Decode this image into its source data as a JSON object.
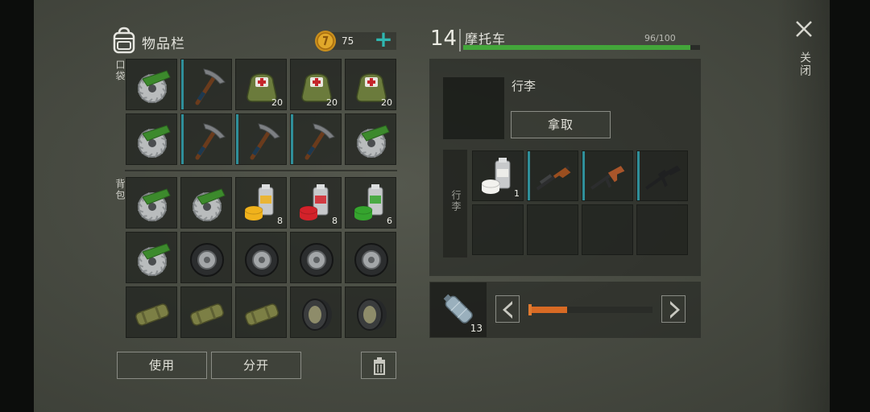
{
  "inventory": {
    "title": "物品栏",
    "coins": "75",
    "add_symbol": "+",
    "pocket_label": "口袋",
    "backpack_label": "背包",
    "pocket_slots": [
      {
        "item": "saw-blade-icon",
        "count": ""
      },
      {
        "item": "pickaxe-icon",
        "count": "",
        "rare": true
      },
      {
        "item": "medkit-bag-icon",
        "count": "20"
      },
      {
        "item": "medkit-bag-icon",
        "count": "20"
      },
      {
        "item": "medkit-bag-icon",
        "count": "20"
      },
      {
        "item": "saw-blade-icon",
        "count": ""
      },
      {
        "item": "pickaxe-icon",
        "count": "",
        "rare": true
      },
      {
        "item": "pickaxe-icon",
        "count": "",
        "rare": true
      },
      {
        "item": "pickaxe-icon",
        "count": "",
        "rare": true
      },
      {
        "item": "saw-blade-icon",
        "count": ""
      }
    ],
    "backpack_slots": [
      {
        "item": "saw-blade-icon",
        "count": ""
      },
      {
        "item": "saw-blade-icon",
        "count": ""
      },
      {
        "item": "paint-can-yellow-icon",
        "count": "8"
      },
      {
        "item": "paint-can-red-icon",
        "count": "8"
      },
      {
        "item": "paint-can-green-icon",
        "count": "6"
      },
      {
        "item": "saw-blade-icon",
        "count": ""
      },
      {
        "item": "tire-icon",
        "count": ""
      },
      {
        "item": "tire-icon",
        "count": ""
      },
      {
        "item": "tire-icon",
        "count": ""
      },
      {
        "item": "tire-icon",
        "count": ""
      },
      {
        "item": "pipe-icon",
        "count": ""
      },
      {
        "item": "pipe-icon",
        "count": ""
      },
      {
        "item": "pipe-icon",
        "count": ""
      },
      {
        "item": "wheel-rim-icon",
        "count": ""
      },
      {
        "item": "wheel-rim-icon",
        "count": ""
      }
    ],
    "use_label": "使用",
    "split_label": "分开"
  },
  "vehicle": {
    "level": "14",
    "name": "摩托车",
    "hp_text": "96/100",
    "hp_fraction": 0.96,
    "luggage_title": "行李",
    "take_label": "拿取",
    "cargo_label": "行李",
    "cargo_slots": [
      {
        "item": "paint-can-white-icon",
        "count": "1"
      },
      {
        "item": "sniper-rifle-icon",
        "count": "",
        "rare": true
      },
      {
        "item": "assault-rifle-icon",
        "count": "",
        "rare": true
      },
      {
        "item": "m16-rifle-icon",
        "count": "",
        "rare": true
      },
      {
        "item": "",
        "count": ""
      },
      {
        "item": "",
        "count": ""
      },
      {
        "item": "",
        "count": ""
      },
      {
        "item": "",
        "count": ""
      }
    ],
    "fuel_count": "13",
    "fuel_fraction": 0.3
  },
  "close_label": "关闭",
  "colors": {
    "accent": "#2fb7b0",
    "hp": "#43a63a",
    "slider": "#d86a24",
    "rare_strip": "#2f8f9a"
  }
}
